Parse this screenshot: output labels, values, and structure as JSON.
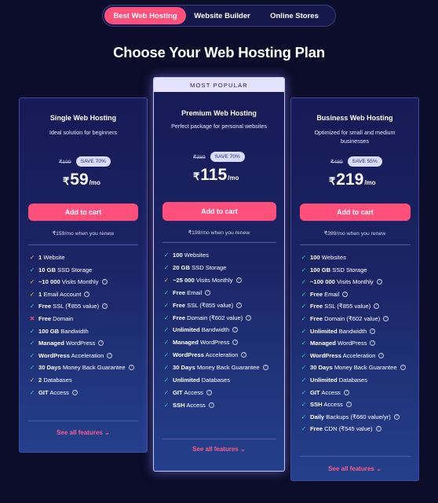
{
  "tabs": [
    {
      "label": "Best Web Hosting",
      "active": true
    },
    {
      "label": "Website Builder",
      "active": false
    },
    {
      "label": "Online Stores",
      "active": false
    }
  ],
  "heading": "Choose Your Web Hosting Plan",
  "colors": {
    "accent": "#ff4f7b",
    "check": "#26d7b3",
    "partial": "#f7b02d",
    "background": "#0b0d2a"
  },
  "plans": [
    {
      "name": "Single Web Hosting",
      "description": "Ideal solution for beginners",
      "old_price": "₹199",
      "save": "SAVE 70%",
      "currency": "₹",
      "price": "59",
      "per": "/mo",
      "cta": "Add to cart",
      "renew": "₹159/mo when you renew",
      "features": [
        {
          "mark": "warn",
          "bold": "1",
          "text": " Website",
          "help": false
        },
        {
          "mark": "ok",
          "bold": "10 GB",
          "text": " SSD Storage",
          "help": false
        },
        {
          "mark": "warn",
          "bold": "~10 000",
          "text": " Visits Monthly",
          "help": true
        },
        {
          "mark": "warn",
          "bold": "1",
          "text": " Email Account",
          "help": true
        },
        {
          "mark": "ok",
          "bold": "Free",
          "text": " SSL (₹855 value)",
          "help": true
        },
        {
          "mark": "no",
          "bold": "Free",
          "text": " Domain",
          "help": false
        },
        {
          "mark": "ok",
          "bold": "100 GB",
          "text": " Bandwidth",
          "help": false
        },
        {
          "mark": "ok",
          "bold": "Managed",
          "text": " WordPress",
          "help": true
        },
        {
          "mark": "ok",
          "bold": "WordPress",
          "text": " Acceleration",
          "help": true
        },
        {
          "mark": "ok",
          "bold": "30 Days",
          "text": " Money Back Guarantee",
          "help": true
        },
        {
          "mark": "warn",
          "bold": "2",
          "text": " Databases",
          "help": false
        },
        {
          "mark": "ok",
          "bold": "GIT",
          "text": " Access",
          "help": true
        }
      ],
      "see_all": "See all features"
    },
    {
      "ribbon": "MOST POPULAR",
      "name": "Premium Web Hosting",
      "description": "Perfect package for personal websites",
      "old_price": "₹389",
      "save": "SAVE 70%",
      "currency": "₹",
      "price": "115",
      "per": "/mo",
      "cta": "Add to cart",
      "renew": "₹199/mo when you renew",
      "features": [
        {
          "mark": "ok",
          "bold": "100",
          "text": " Websites",
          "help": false
        },
        {
          "mark": "ok",
          "bold": "20 GB",
          "text": " SSD Storage",
          "help": false
        },
        {
          "mark": "warn",
          "bold": "~25 000",
          "text": " Visits Monthly",
          "help": true
        },
        {
          "mark": "ok",
          "bold": "Free",
          "text": " Email",
          "help": true
        },
        {
          "mark": "ok",
          "bold": "Free",
          "text": " SSL (₹855 value)",
          "help": true
        },
        {
          "mark": "ok",
          "bold": "Free",
          "text": " Domain (₹602 value)",
          "help": true
        },
        {
          "mark": "ok",
          "bold": "Unlimited",
          "text": " Bandwidth",
          "help": true
        },
        {
          "mark": "ok",
          "bold": "Managed",
          "text": " WordPress",
          "help": true
        },
        {
          "mark": "ok",
          "bold": "WordPress",
          "text": " Acceleration",
          "help": true
        },
        {
          "mark": "ok",
          "bold": "30 Days",
          "text": " Money Back Guarantee",
          "help": true
        },
        {
          "mark": "ok",
          "bold": "Unlimited",
          "text": " Databases",
          "help": false
        },
        {
          "mark": "ok",
          "bold": "GIT",
          "text": " Access",
          "help": true
        },
        {
          "mark": "ok",
          "bold": "SSH",
          "text": " Access",
          "help": true
        }
      ],
      "see_all": "See all features"
    },
    {
      "name": "Business Web Hosting",
      "description": "Optimized for small and medium businesses",
      "old_price": "₹489",
      "save": "SAVE 55%",
      "currency": "₹",
      "price": "219",
      "per": "/mo",
      "cta": "Add to cart",
      "renew": "₹399/mo when you renew",
      "features": [
        {
          "mark": "ok",
          "bold": "100",
          "text": " Websites",
          "help": false
        },
        {
          "mark": "ok",
          "bold": "100 GB",
          "text": " SSD Storage",
          "help": false
        },
        {
          "mark": "ok",
          "bold": "~100 000",
          "text": " Visits Monthly",
          "help": true
        },
        {
          "mark": "ok",
          "bold": "Free",
          "text": " Email",
          "help": true
        },
        {
          "mark": "ok",
          "bold": "Free",
          "text": " SSL (₹855 value)",
          "help": true
        },
        {
          "mark": "ok",
          "bold": "Free",
          "text": " Domain (₹602 value)",
          "help": true
        },
        {
          "mark": "ok",
          "bold": "Unlimited",
          "text": " Bandwidth",
          "help": true
        },
        {
          "mark": "ok",
          "bold": "Managed",
          "text": " WordPress",
          "help": true
        },
        {
          "mark": "ok",
          "bold": "WordPress",
          "text": " Acceleration",
          "help": true
        },
        {
          "mark": "ok",
          "bold": "30 Days",
          "text": " Money Back Guarantee",
          "help": true
        },
        {
          "mark": "ok",
          "bold": "Unlimited",
          "text": " Databases",
          "help": false
        },
        {
          "mark": "ok",
          "bold": "GIT",
          "text": " Access",
          "help": true
        },
        {
          "mark": "ok",
          "bold": "SSH",
          "text": " Access",
          "help": true
        },
        {
          "mark": "ok",
          "bold": "Daily",
          "text": " Backups (₹660 value/yr)",
          "help": true
        },
        {
          "mark": "ok",
          "bold": "Free",
          "text": " CDN (₹545 value)",
          "help": true
        }
      ],
      "see_all": "See all features"
    }
  ]
}
